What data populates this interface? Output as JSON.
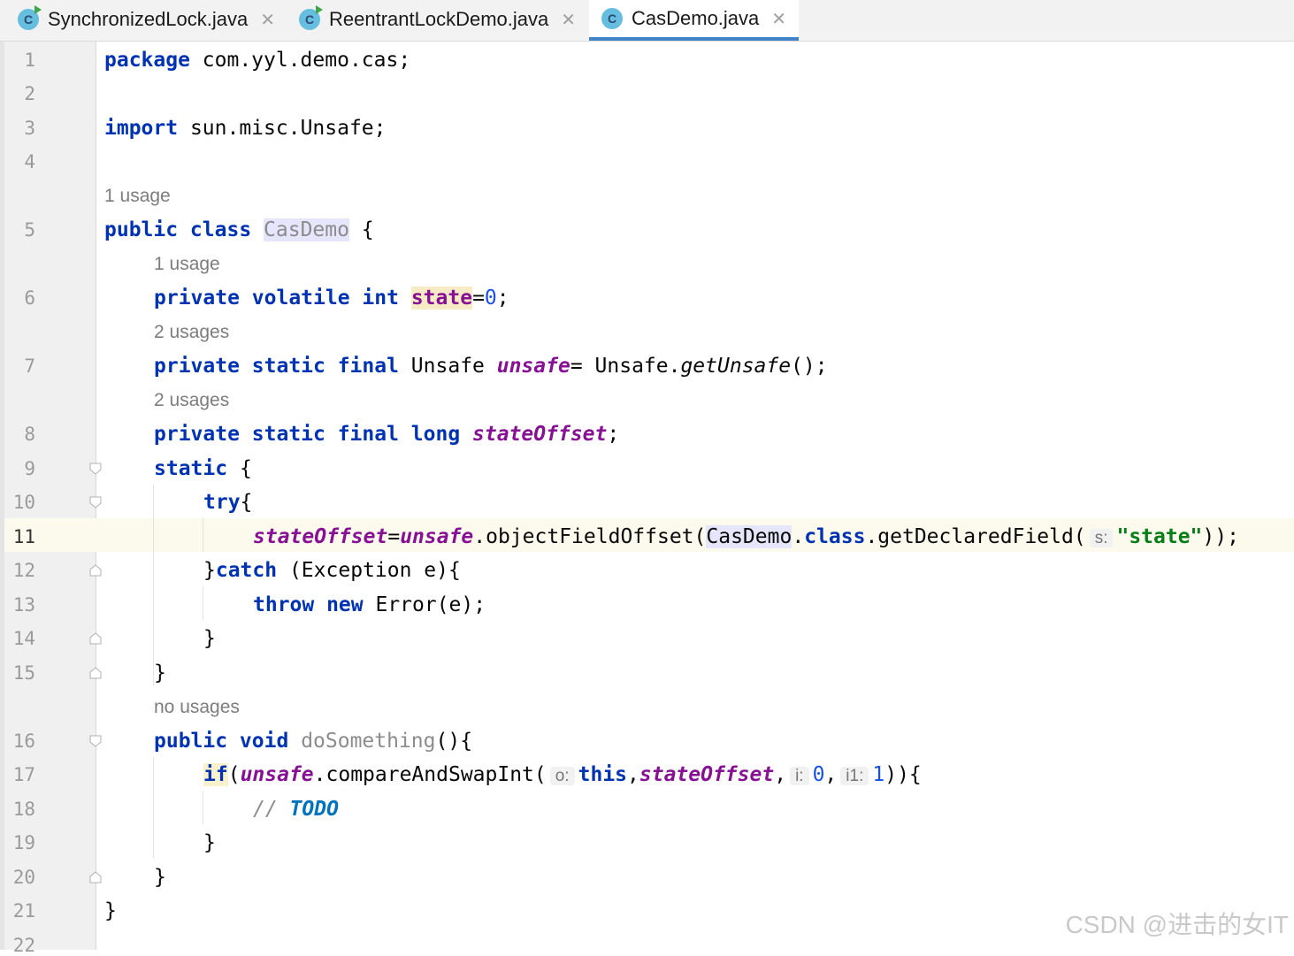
{
  "tabs": [
    {
      "label": "SynchronizedLock.java",
      "icon": "java-class-run-icon",
      "active": false
    },
    {
      "label": "ReentrantLockDemo.java",
      "icon": "java-class-run-icon",
      "active": false
    },
    {
      "label": "CasDemo.java",
      "icon": "java-class-icon",
      "active": true
    }
  ],
  "tab_icon_letter": "C",
  "close_glyph": "✕",
  "line_numbers": [
    "1",
    "2",
    "3",
    "4",
    "5",
    "6",
    "7",
    "8",
    "9",
    "10",
    "11",
    "12",
    "13",
    "14",
    "15",
    "16",
    "17",
    "18",
    "19",
    "20",
    "21",
    "22"
  ],
  "usages": {
    "class": "1 usage",
    "state": "1 usage",
    "unsafe": "2 usages",
    "stateOffset": "2 usages",
    "doSomething": "no usages"
  },
  "code": {
    "l1_kw": "package",
    "l1_rest": " com.yyl.demo.cas;",
    "l3_kw": "import",
    "l3_rest": " sun.misc.Unsafe;",
    "l5_kw": "public class",
    "l5_name": "CasDemo",
    "l5_rest": " {",
    "l6_kw": "private volatile int",
    "l6_name": "state",
    "l6_eq": "=",
    "l6_num": "0",
    "l6_end": ";",
    "l7_kw": "private static final",
    "l7_type": " Unsafe ",
    "l7_name": "unsafe",
    "l7_eq": "= Unsafe.",
    "l7_call": "getUnsafe",
    "l7_end": "();",
    "l8_kw": "private static final long",
    "l8_name": "stateOffset",
    "l8_end": ";",
    "l9_kw": "static",
    "l9_rest": " {",
    "l10_kw": "try",
    "l10_rest": "{",
    "l11_a": "stateOffset",
    "l11_b": "=",
    "l11_c": "unsafe",
    "l11_d": ".objectFieldOffset(",
    "l11_e": "CasDemo",
    "l11_f": ".",
    "l11_g": "class",
    "l11_h": ".getDeclaredField(",
    "l11_hint": "s:",
    "l11_str": "\"state\"",
    "l11_end": "));",
    "l12_a": "}",
    "l12_kw": "catch",
    "l12_rest": " (Exception e){",
    "l13_kw": "throw new",
    "l13_rest": " Error(e);",
    "l14": "}",
    "l15": "}",
    "l16_kw": "public void",
    "l16_name": "doSomething",
    "l16_rest": "(){",
    "l17_kw": "if",
    "l17_a": "(",
    "l17_b": "unsafe",
    "l17_c": ".compareAndSwapInt(",
    "l17_hint1": "o:",
    "l17_this": "this",
    "l17_comma": ",",
    "l17_d": "stateOffset",
    "l17_e": ",",
    "l17_hint2": "i:",
    "l17_n1": "0",
    "l17_f": ",",
    "l17_hint3": "i1:",
    "l17_n2": "1",
    "l17_end": ")){",
    "l18_slash": "// ",
    "l18_todo": "TODO",
    "l19": "}",
    "l20": "}",
    "l21": "}"
  },
  "watermark": "CSDN @进击的女IT"
}
